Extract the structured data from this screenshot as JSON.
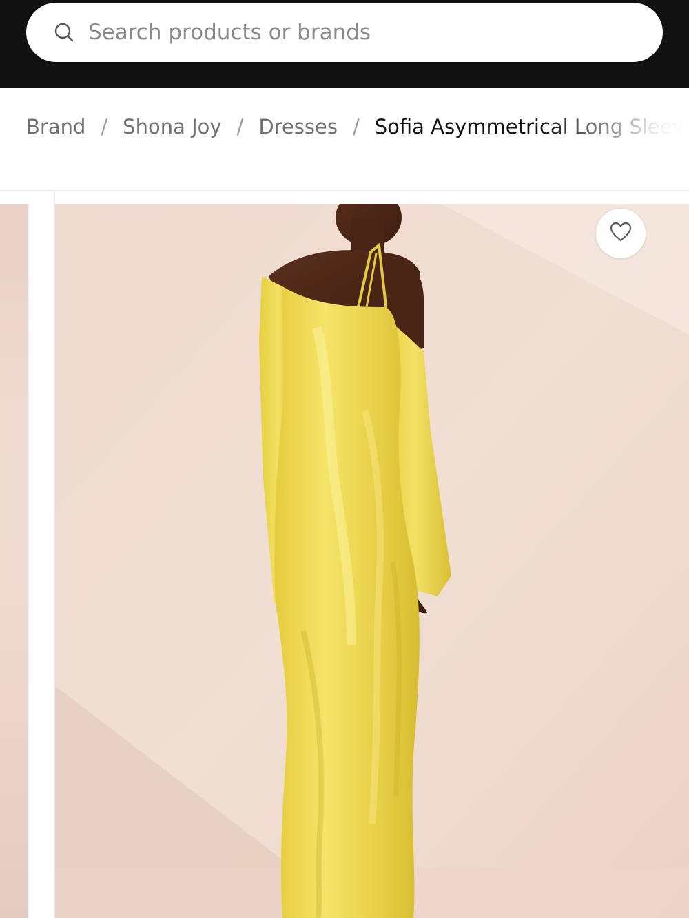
{
  "search": {
    "placeholder": "Search products or brands"
  },
  "breadcrumb": {
    "items": [
      {
        "label": "Brand"
      },
      {
        "label": "Shona Joy"
      },
      {
        "label": "Dresses"
      }
    ],
    "separator": "/",
    "current": "Sofia Asymmetrical Long Sleev"
  },
  "product_gallery": {
    "favorite_icon": "heart-outline-icon",
    "image_description_colors": {
      "background": "#efdcd0",
      "dress": "#ecd84e"
    }
  },
  "colors": {
    "topbar": "#111111",
    "breadcrumb_link": "#707070",
    "breadcrumb_current": "#111111"
  }
}
